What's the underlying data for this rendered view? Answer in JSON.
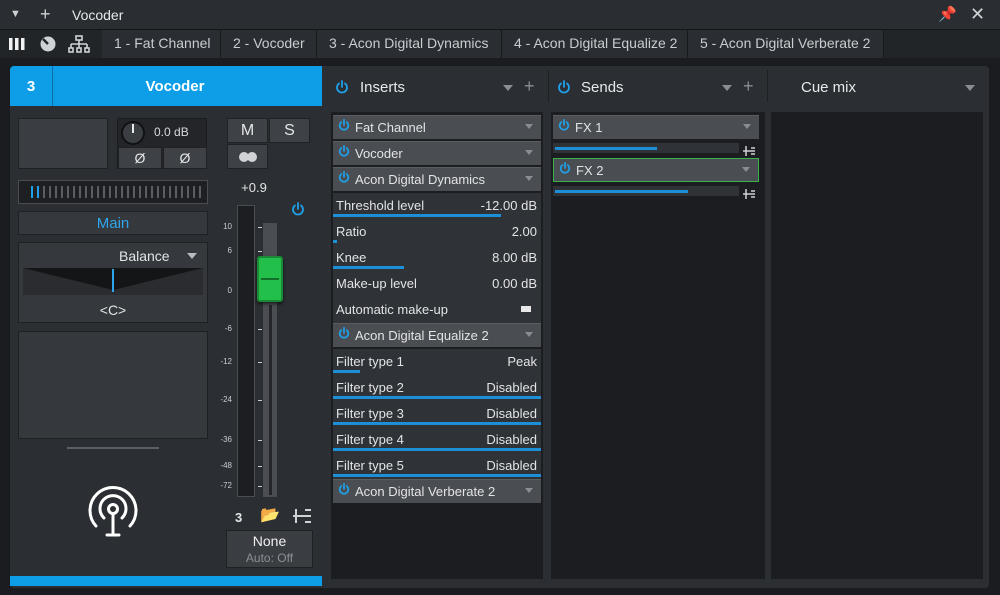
{
  "window": {
    "title": "Vocoder"
  },
  "tabs": [
    "1 - Fat Channel",
    "2 - Vocoder",
    "3 - Acon Digital Dynamics",
    "4 - Acon Digital Equalize 2",
    "5 - Acon Digital Verberate 2"
  ],
  "channel": {
    "number": "3",
    "name": "Vocoder",
    "gain": "0.0 dB",
    "phase_left": "Ø",
    "phase_right": "Ø",
    "mute": "M",
    "solo": "S",
    "output": "Main",
    "pan_mode": "Balance",
    "pan_value": "<C>",
    "fader_value": "+0.9",
    "fader_level": 0.52,
    "scale": [
      "10",
      "6",
      "0",
      "-6",
      "-12",
      "-24",
      "-36",
      "-48",
      "-72"
    ],
    "bottom_number": "3",
    "automation": "None",
    "auto_state": "Auto: Off"
  },
  "inserts": {
    "title": "Inserts",
    "slots": [
      {
        "name": "Fat Channel"
      },
      {
        "name": "Vocoder"
      },
      {
        "name": "Acon Digital Dynamics",
        "params": [
          {
            "label": "Threshold level",
            "value": "-12.00 dB",
            "level": 0.81
          },
          {
            "label": "Ratio",
            "value": "2.00",
            "level": 0.02
          },
          {
            "label": "Knee",
            "value": "8.00 dB",
            "level": 0.34
          },
          {
            "label": "Make-up level",
            "value": "0.00 dB",
            "level": 0.0
          },
          {
            "label": "Automatic make-up",
            "value": "",
            "level": 0.0
          }
        ]
      },
      {
        "name": "Acon Digital Equalize 2",
        "params": [
          {
            "label": "Filter type 1",
            "value": "Peak",
            "level": 0.13
          },
          {
            "label": "Filter type 2",
            "value": "Disabled",
            "level": 1.0
          },
          {
            "label": "Filter type 3",
            "value": "Disabled",
            "level": 1.0
          },
          {
            "label": "Filter type 4",
            "value": "Disabled",
            "level": 1.0
          },
          {
            "label": "Filter type 5",
            "value": "Disabled",
            "level": 1.0
          }
        ]
      },
      {
        "name": "Acon Digital Verberate 2"
      }
    ]
  },
  "sends": {
    "title": "Sends",
    "items": [
      {
        "name": "FX 1",
        "level": 0.56
      },
      {
        "name": "FX 2",
        "level": 0.73
      }
    ]
  },
  "cue": {
    "title": "Cue mix"
  },
  "colors": {
    "accent": "#0e9ee8",
    "fader": "#22c04a",
    "selected": "#37b34a"
  }
}
